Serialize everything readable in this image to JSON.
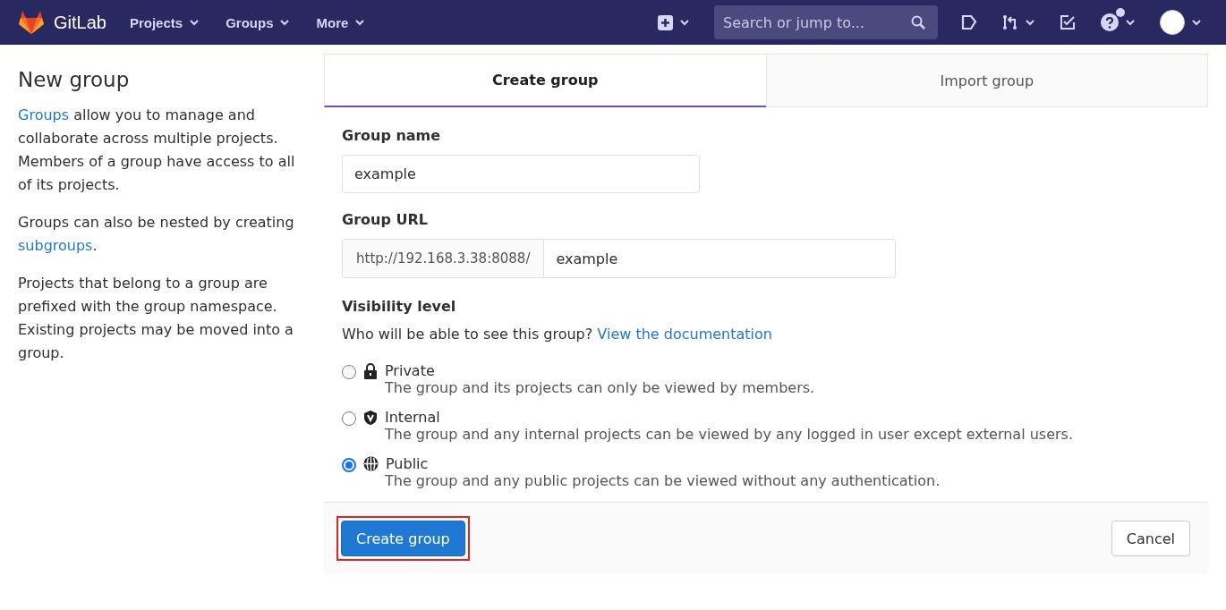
{
  "navbar": {
    "brand": "GitLab",
    "menus": [
      {
        "label": "Projects"
      },
      {
        "label": "Groups"
      },
      {
        "label": "More"
      }
    ],
    "search": {
      "placeholder": "Search or jump to..."
    },
    "help_badge": true
  },
  "sidebar": {
    "title": "New group",
    "paragraphs": [
      [
        {
          "kind": "link",
          "text": "Groups"
        },
        {
          "kind": "text",
          "text": " allow you to manage and collaborate across multiple projects. Members of a group have access to all of its projects."
        }
      ],
      [
        {
          "kind": "text",
          "text": "Groups can also be nested by creating "
        },
        {
          "kind": "link",
          "text": "subgroups"
        },
        {
          "kind": "text",
          "text": "."
        }
      ],
      [
        {
          "kind": "text",
          "text": "Projects that belong to a group are prefixed with the group namespace. Existing projects may be moved into a group."
        }
      ]
    ]
  },
  "tabs": [
    {
      "label": "Create group",
      "selected": true
    },
    {
      "label": "Import group",
      "selected": false
    }
  ],
  "form": {
    "group_name": {
      "label": "Group name",
      "value": "example"
    },
    "group_url": {
      "label": "Group URL",
      "prefix": "http://192.168.3.38:8088/",
      "value": "example"
    },
    "visibility": {
      "label": "Visibility level",
      "help": "Who will be able to see this group?",
      "help_link": "View the documentation",
      "options": [
        {
          "kind": "private",
          "label": "Private",
          "description": "The group and its projects can only be viewed by members.",
          "selected": false
        },
        {
          "kind": "internal",
          "label": "Internal",
          "description": "The group and any internal projects can be viewed by any logged in user except external users.",
          "selected": false
        },
        {
          "kind": "public",
          "label": "Public",
          "description": "The group and any public projects can be viewed without any authentication.",
          "selected": true
        }
      ]
    }
  },
  "actions": {
    "submit": {
      "label": "Create group",
      "highlighted": true
    },
    "cancel": {
      "label": "Cancel"
    }
  }
}
